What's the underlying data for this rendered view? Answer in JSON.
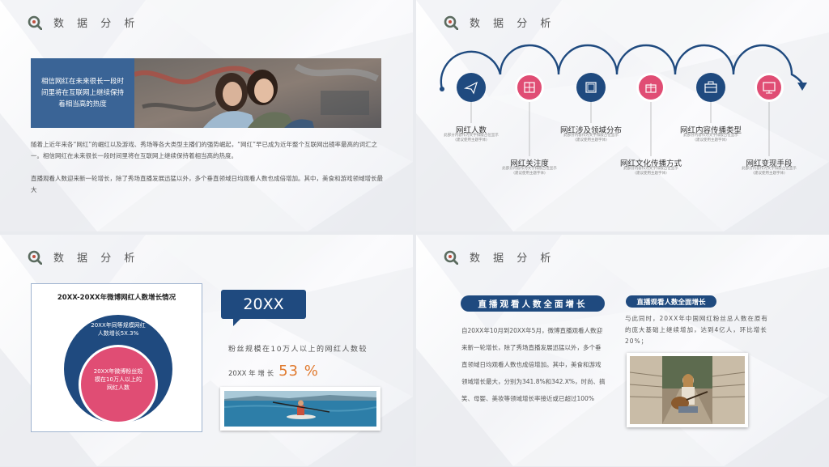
{
  "section_title": "数 据 分 析",
  "colors": {
    "navy": "#1f4a7f",
    "pink": "#e04d74",
    "text": "#555555",
    "accent_orange": "#e07a2e"
  },
  "slide1": {
    "box_text": "相信网红在未来很长一段时间里将在互联网上继续保持着相当高的热度",
    "paragraph1": "随着上近年来各“网红”的崛红以及游戏、秀场等各大类型主播们的强势崛起，“网红”早已成为近年整个互联网出镜率最高的词汇之一。相信网红在未来很长一段时间里将在互联网上继续保持着相当高的热度。",
    "paragraph2": "直播观看人数迎来新一轮增长，除了秀场直播发展迅猛以外，多个垂直领域日均观看人数也成倍增加。其中，美食和游戏领域增长最大"
  },
  "slide2": {
    "items": [
      {
        "label": "网红人数",
        "icon": "paper-plane-icon",
        "color": "navy"
      },
      {
        "label": "网红关注度",
        "icon": "grid-icon",
        "color": "pink"
      },
      {
        "label": "网红涉及领域分布",
        "icon": "image-icon",
        "color": "navy"
      },
      {
        "label": "网红文化传播方式",
        "icon": "gift-icon",
        "color": "pink"
      },
      {
        "label": "网红内容传播类型",
        "icon": "briefcase-icon",
        "color": "navy"
      },
      {
        "label": "网红变现手段",
        "icon": "monitor-icon",
        "color": "pink"
      }
    ],
    "sub_line1": "此部分内容作为文字排版占位显示",
    "sub_line2": "(建议使用主题字体)"
  },
  "slide3": {
    "chart_title": "20XX-20XX年微博网红人数增长情况",
    "outer_label": "20XX年同等规模网红人数增长5X.3%",
    "inner_label": "20XX年微博粉丝规模在10万人以上的网红人数",
    "bubble": "20XX",
    "text1": "粉丝规模在10万人以上的网红人数较",
    "text2_prefix": "20XX 年 增 长",
    "percent": "53 %"
  },
  "slide4": {
    "pill1": "直播观看人数全面增长",
    "text1": "自20XX年10月到20XX年5月，微博直播观看人数迎来新一轮增长，除了秀场直播发展迅猛以外，多个垂直领域日均观看人数也成倍增加。其中，美食和游戏领域增长最大，分别为341.8%和342.X%，时尚、搞笑、母婴、美妆等领域增长率接近或已超过100%",
    "pill2": "直播观看人数全面增长",
    "text2": "与此同时，20XX年中国网红粉丝总人数在原有的庞大基础上继续增加，达到4亿人，环比增长20%；"
  }
}
